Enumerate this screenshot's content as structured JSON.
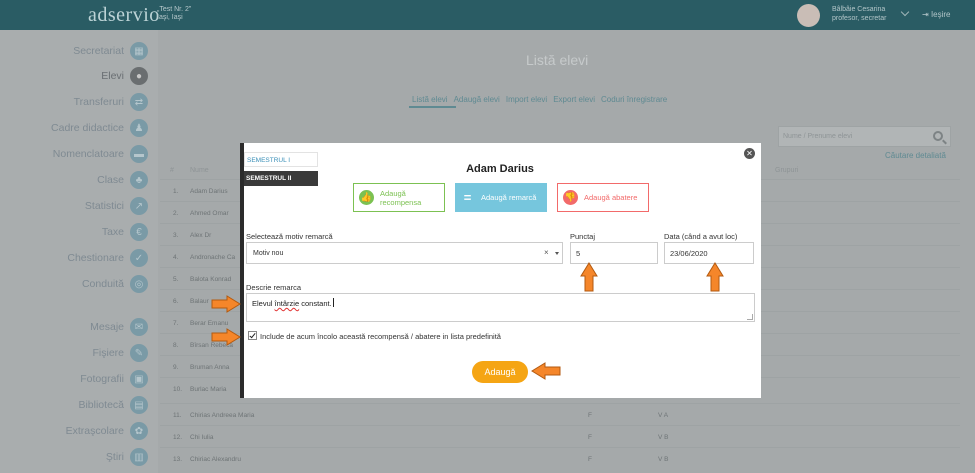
{
  "topbar": {
    "logo": "adservio",
    "school_line1": "„Test Nr. 2”",
    "school_line2": "Iaşi, Iaşi",
    "user_name": "Bâlbâie Cesarina",
    "user_role": "profesor, secretar",
    "logout": "Ieşire"
  },
  "sidebar": {
    "items": [
      {
        "label": "Secretariat",
        "icon": "building-icon"
      },
      {
        "label": "Elevi",
        "icon": "student-icon"
      },
      {
        "label": "Transferuri",
        "icon": "transfer-icon"
      },
      {
        "label": "Cadre didactice",
        "icon": "teacher-icon"
      },
      {
        "label": "Nomenclatoare",
        "icon": "list-icon"
      },
      {
        "label": "Clase",
        "icon": "group-icon"
      },
      {
        "label": "Statistici",
        "icon": "chart-icon"
      },
      {
        "label": "Taxe",
        "icon": "money-icon"
      },
      {
        "label": "Chestionare",
        "icon": "questionnaire-icon"
      },
      {
        "label": "Conduită",
        "icon": "conduct-icon"
      },
      {
        "label": "Mesaje",
        "icon": "message-icon"
      },
      {
        "label": "Fişiere",
        "icon": "file-icon"
      },
      {
        "label": "Fotografii",
        "icon": "photo-icon"
      },
      {
        "label": "Bibliotecă",
        "icon": "library-icon"
      },
      {
        "label": "Extraşcolare",
        "icon": "extracurricular-icon"
      },
      {
        "label": "Ştiri",
        "icon": "news-icon"
      }
    ]
  },
  "page": {
    "title": "Listă elevi",
    "tabs": [
      "Listă elevi",
      "Adaugă elevi",
      "Import elevi",
      "Export elevi",
      "Coduri înregistrare"
    ],
    "search_placeholder": "Nume / Prenume elevi",
    "advanced_search": "Căutare detaliată",
    "col_num": "#",
    "col_name": "Nume",
    "col_group": "Grupuri",
    "rows": [
      {
        "num": "1.",
        "name": "Adam Darius"
      },
      {
        "num": "2.",
        "name": "Ahmed Omar"
      },
      {
        "num": "3.",
        "name": "Alex Dr"
      },
      {
        "num": "4.",
        "name": "Andronache Ca"
      },
      {
        "num": "5.",
        "name": "Balota Konrad"
      },
      {
        "num": "6.",
        "name": "Balaur"
      },
      {
        "num": "7.",
        "name": "Berar Emanu"
      },
      {
        "num": "8.",
        "name": "Bîrsan Rebeca"
      },
      {
        "num": "9.",
        "name": "Bruman Anna"
      },
      {
        "num": "10.",
        "name": "Burlac Maria"
      },
      {
        "num": "11.",
        "name": "Chirias Andreea Maria",
        "sex": "F",
        "class": "V A"
      },
      {
        "num": "12.",
        "name": "Chi Iulia",
        "sex": "F",
        "class": "V B"
      },
      {
        "num": "13.",
        "name": "Chiriac Alexandru",
        "sex": "F",
        "class": "V B"
      }
    ]
  },
  "modal": {
    "semester1": "SEMESTRUL I",
    "semester2": "SEMESTRUL II",
    "student_name": "Adam Darius",
    "btn_recompensa": "Adaugă recompensa",
    "btn_remarca": "Adaugă remarcă",
    "btn_abatere": "Adaugă abatere",
    "label_motiv": "Selectează motiv remarcă",
    "motiv_value": "Motiv nou",
    "label_punctaj": "Punctaj",
    "punctaj_value": "5",
    "label_data": "Data (când a avut loc)",
    "data_value": "23/06/2020",
    "label_descriere": "Descrie remarca",
    "descriere_word1": "Elevul",
    "descriere_word2": "întârzie",
    "descriere_word3": "constant.",
    "checkbox_label": "Include de acum încolo această recompensă / abatere in lista predefinită",
    "checkbox_checked": true,
    "add_button": "Adaugă"
  },
  "colors": {
    "topbar": "#2a5c64",
    "recompensa": "#7cc152",
    "remarca": "#76c6dd",
    "abatere": "#f26a6a",
    "add_button": "#f5a514",
    "annotation_arrow": "#f5862a"
  }
}
